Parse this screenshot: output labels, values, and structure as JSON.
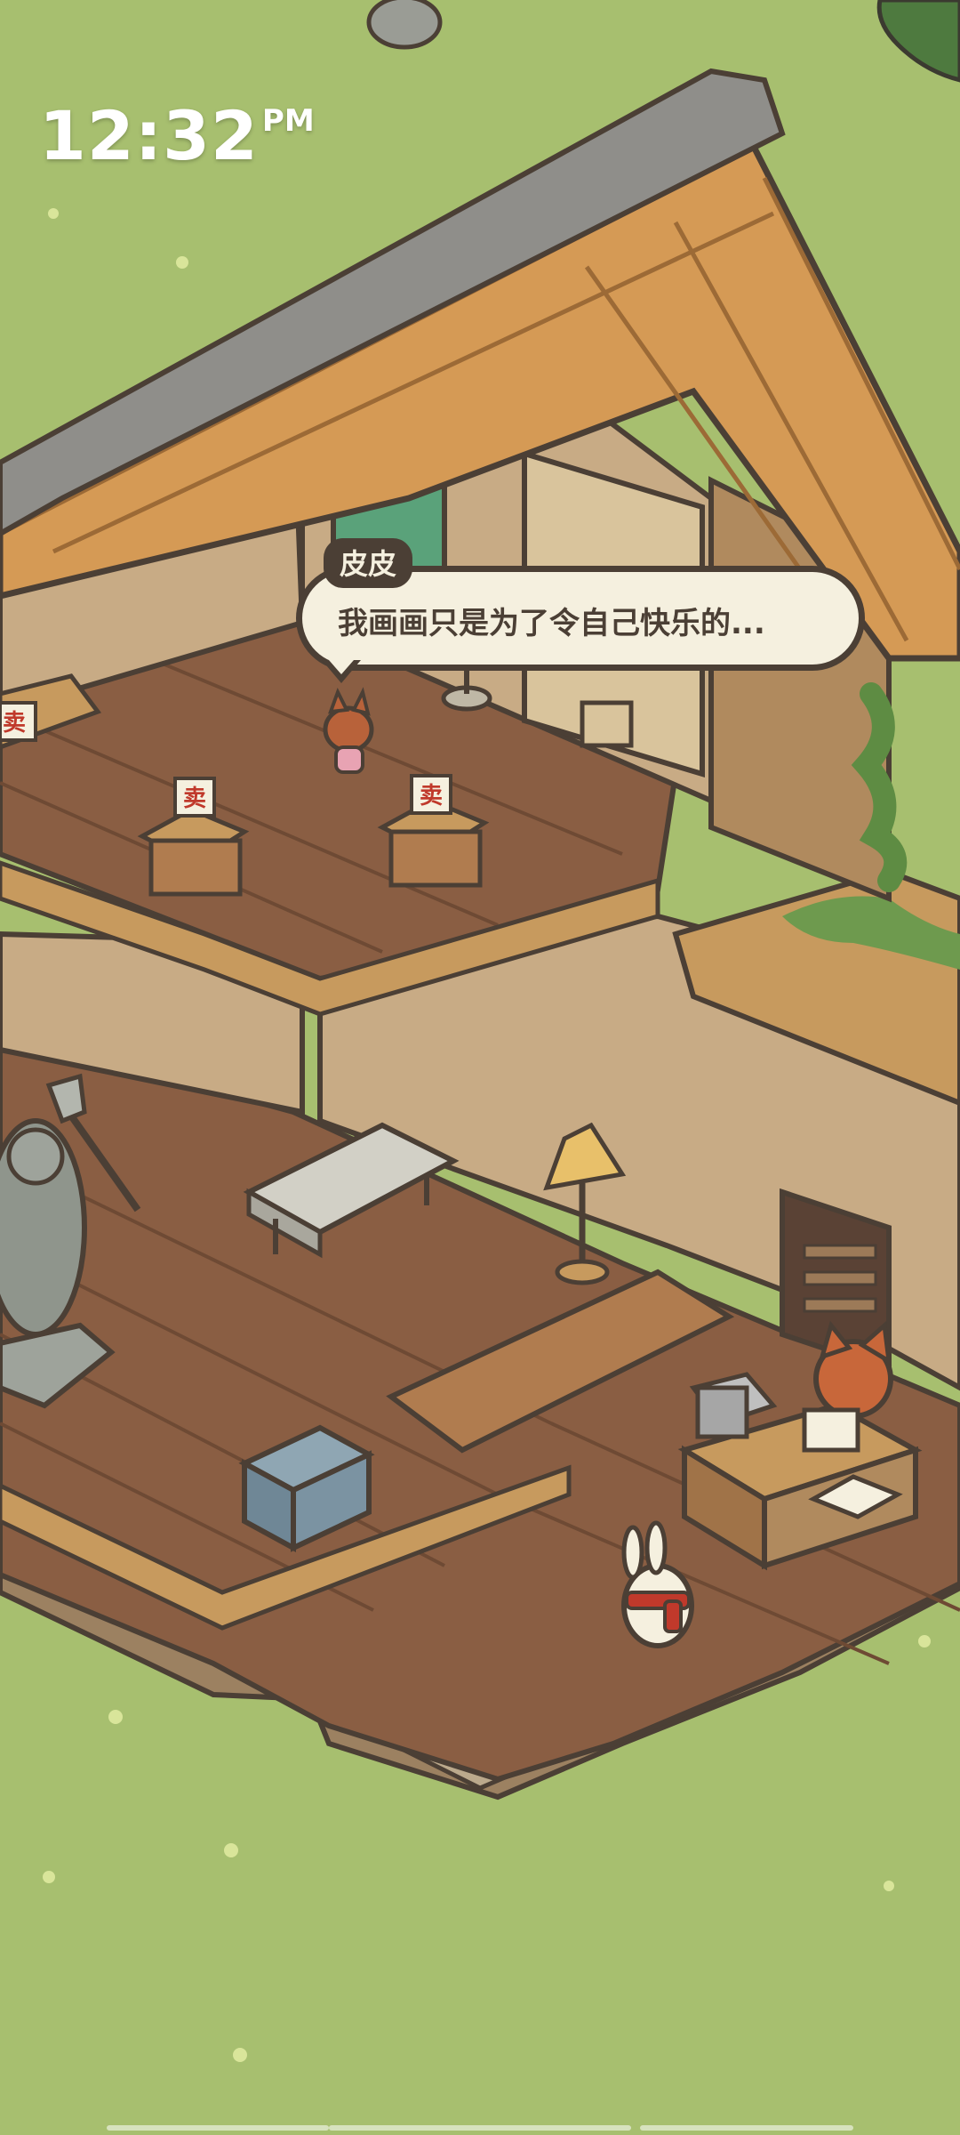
{
  "status_bar": {
    "time": "12:32",
    "ampm": "PM"
  },
  "dialogue": {
    "speaker": "皮皮",
    "text": "我画画只是为了令自己快乐的..."
  },
  "shop_signs": [
    "卖",
    "卖",
    "卖"
  ],
  "colors": {
    "grass": "#a7bf6f",
    "roof": "#d59a55",
    "floor": "#8a5e43",
    "wall": "#c8ab85",
    "outline": "#4b3f35",
    "bubble": "#f5f0df"
  }
}
